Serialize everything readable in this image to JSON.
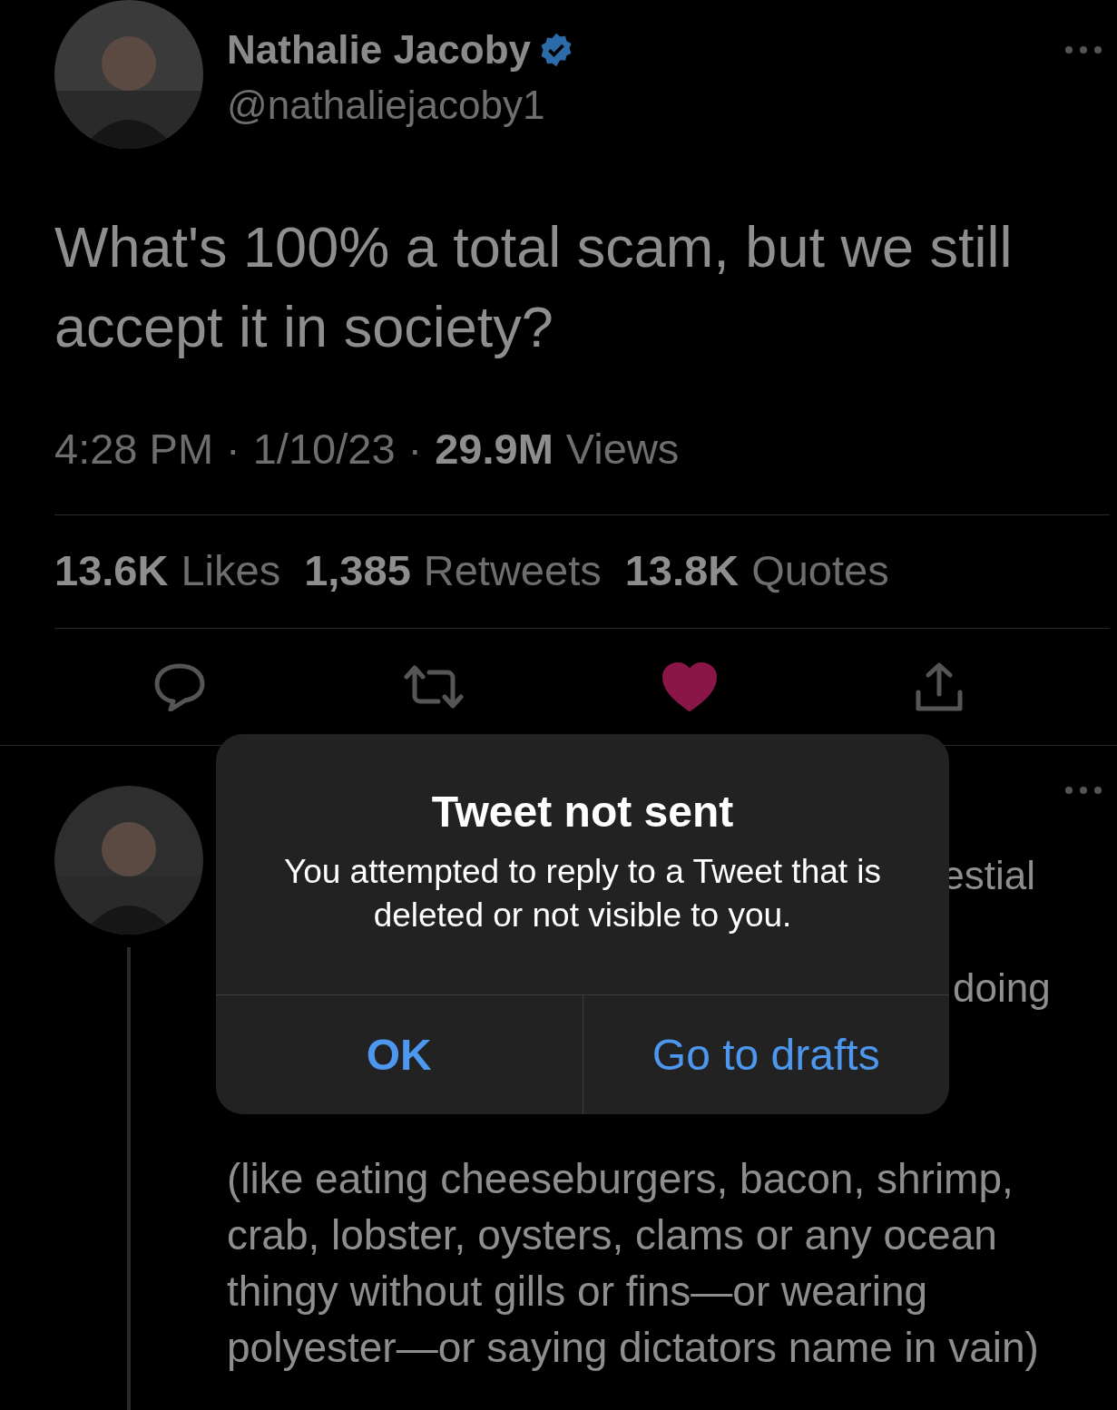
{
  "tweet": {
    "author": {
      "name": "Nathalie Jacoby",
      "verified": true,
      "handle": "@nathaliejacoby1"
    },
    "text": "What's 100% a total scam, but we still accept it in society?",
    "meta": {
      "time": "4:28 PM",
      "separator": "·",
      "date": "1/10/23",
      "views_count": "29.9M",
      "views_label": "Views"
    },
    "stats": [
      {
        "count": "13.6K",
        "label": "Likes"
      },
      {
        "count": "1,385",
        "label": "Retweets"
      },
      {
        "count": "13.8K",
        "label": "Quotes"
      }
    ],
    "liked": true
  },
  "reply": {
    "fragments": [
      "estial",
      "doing"
    ],
    "text": "(like eating cheeseburgers, bacon, shrimp, crab, lobster, oysters, clams or any ocean thingy without gills or fins—or wearing polyester—or saying dictators name in vain)"
  },
  "alert": {
    "title": "Tweet not sent",
    "message": "You attempted to reply to a Tweet that is deleted or not visible to you.",
    "buttons": [
      {
        "label": "OK",
        "bold": true
      },
      {
        "label": "Go to drafts",
        "bold": false
      }
    ]
  }
}
